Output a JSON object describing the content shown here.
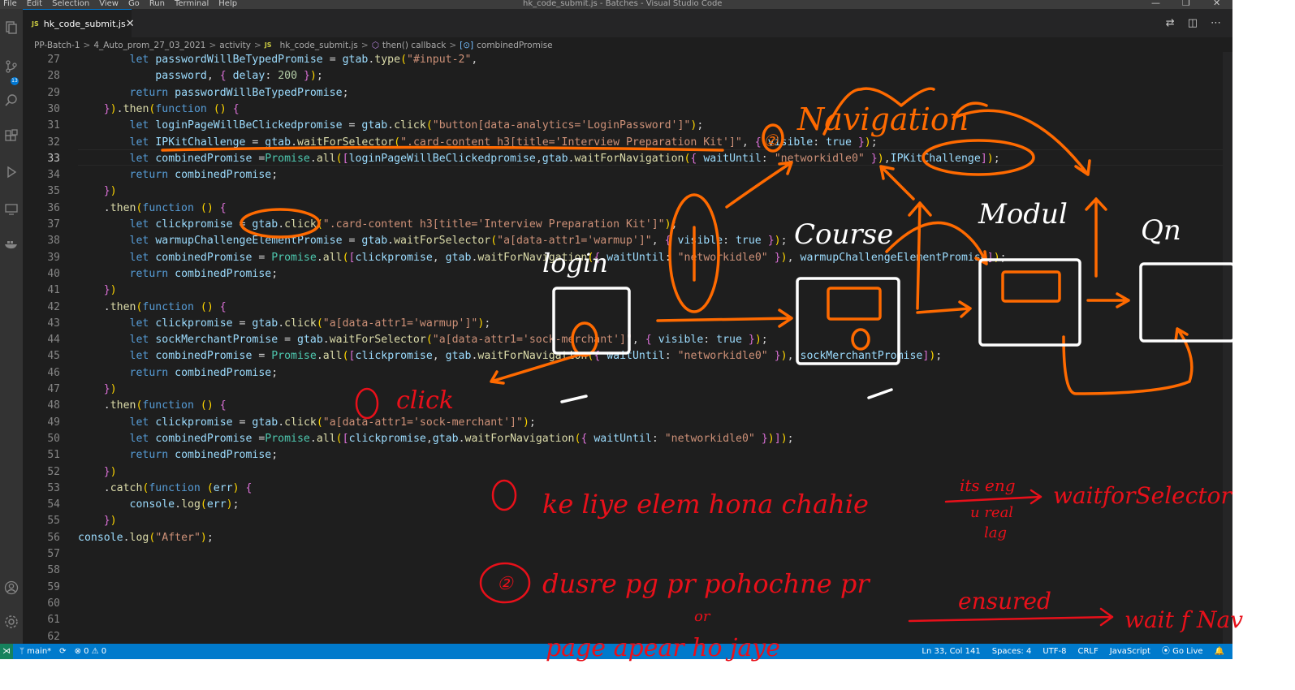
{
  "titlebar": {
    "menu": [
      "File",
      "Edit",
      "Selection",
      "View",
      "Go",
      "Run",
      "Terminal",
      "Help"
    ],
    "window_title": "hk_code_submit.js - Batches - Visual Studio Code",
    "controls": [
      "—",
      "❐",
      "✕"
    ]
  },
  "tab": {
    "badge": "JS",
    "label": "hk_code_submit.js",
    "close": "✕"
  },
  "tab_actions": [
    "⇄",
    "◫",
    "⋯"
  ],
  "breadcrumb": {
    "items": [
      "PP-Batch-1",
      "4_Auto_prom_27_03_2021",
      "activity",
      "hk_code_submit.js",
      "then() callback",
      "combinedPromise"
    ],
    "separator": ">"
  },
  "editor": {
    "line_numbers": [
      "27",
      "28",
      "29",
      "30",
      "31",
      "32",
      "33",
      "34",
      "35",
      "36",
      "37",
      "38",
      "39",
      "40",
      "41",
      "42",
      "43",
      "44",
      "45",
      "46",
      "47",
      "48",
      "49",
      "50",
      "51",
      "52",
      "53",
      "54",
      "55",
      "56",
      "57",
      "58",
      "59",
      "60",
      "61",
      "62"
    ],
    "current_line": "33",
    "lines": [
      "        let passwordWillBeTypedPromise = gtab.type(\"#input-2\",",
      "            password, { delay: 200 });",
      "        return passwordWillBeTypedPromise;",
      "    }).then(function () {",
      "        let loginPageWillBeClickedpromise = gtab.click(\"button[data-analytics='LoginPassword']\");",
      "        let IPKitChallenge = gtab.waitForSelector(\".card-content h3[title='Interview Preparation Kit']\", { visible: true });",
      "        let combinedPromise =Promise.all([loginPageWillBeClickedpromise,gtab.waitForNavigation({ waitUntil: \"networkidle0\" }),IPKitChallenge]);",
      "        return combinedPromise;",
      "    })",
      "    .then(function () {",
      "        let clickpromise = gtab.click(\".card-content h3[title='Interview Preparation Kit']\");",
      "        let warmupChallengeElementPromise = gtab.waitForSelector(\"a[data-attr1='warmup']\", { visible: true });",
      "        let combinedPromise = Promise.all([clickpromise, gtab.waitForNavigation({ waitUntil: \"networkidle0\" }), warmupChallengeElementPromise]);",
      "        return combinedPromise;",
      "    })",
      "    .then(function () {",
      "        let clickpromise = gtab.click(\"a[data-attr1='warmup']\");",
      "        let sockMerchantPromise = gtab.waitForSelector(\"a[data-attr1='sock-merchant']\", { visible: true });",
      "        let combinedPromise = Promise.all([clickpromise, gtab.waitForNavigation({ waitUntil: \"networkidle0\" }), sockMerchantPromise]);",
      "        return combinedPromise;",
      "    })",
      "    .then(function () {",
      "        let clickpromise = gtab.click(\"a[data-attr1='sock-merchant']\");",
      "        let combinedPromise =Promise.all([clickpromise,gtab.waitForNavigation({ waitUntil: \"networkidle0\" })]);",
      "        return combinedPromise;",
      "    })",
      "    .catch(function (err) {",
      "        console.log(err);",
      "    })",
      "console.log(\"After\");",
      "",
      "",
      "",
      "",
      "",
      ""
    ]
  },
  "statusbar": {
    "remote": "⋊",
    "branch": "ᛘ main*",
    "sync": "⟳",
    "problems": "⊗ 0 ⚠ 0",
    "position": "Ln 33, Col 141",
    "spaces": "Spaces: 4",
    "encoding": "UTF-8",
    "eol": "CRLF",
    "language": "JavaScript",
    "golive": "⦿ Go Live",
    "notifications": "🔔"
  },
  "activitybar": {
    "scm_badge": "13"
  },
  "annotations": {
    "navigation": "Navigation",
    "one": "①",
    "two": "②",
    "login": "login",
    "course": "Course",
    "module": "Modul",
    "question": "Qn",
    "click": "click",
    "note1": "ke liye elem hona chahie",
    "its_eng": "its eng",
    "u_real": "u real",
    "lag": "lag",
    "wait_for_selector": "waitforSelector",
    "note2": "dusre pg pr pohochne pr",
    "or": "or",
    "note3": "page   apear   ho   jaye",
    "ensured": "ensured",
    "wait_for_nav": "wait f Nav"
  },
  "colors": {
    "editor_bg": "#1e1e1e",
    "statusbar_bg": "#007acc",
    "ink_orange": "#ff6a00",
    "ink_red": "#e8101a",
    "ink_white": "#ffffff"
  }
}
